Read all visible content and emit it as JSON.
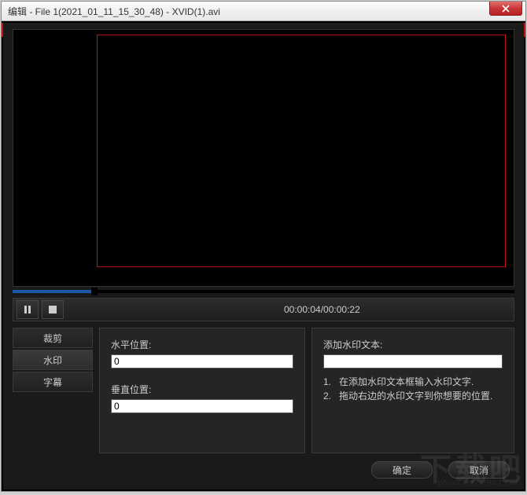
{
  "window": {
    "title": "编辑 - File 1(2021_01_11_15_30_48) - XVID(1).avi"
  },
  "player": {
    "time_display": "00:00:04/00:00:22"
  },
  "tabs": {
    "crop": "裁剪",
    "watermark": "水印",
    "subtitle": "字幕"
  },
  "watermark_panel": {
    "h_pos_label": "水平位置:",
    "h_pos_value": "0",
    "v_pos_label": "垂直位置:",
    "v_pos_value": "0",
    "add_text_label": "添加水印文本:",
    "add_text_value": "",
    "instr1_num": "1.",
    "instr1_text": "在添加水印文本框输入水印文字.",
    "instr2_num": "2.",
    "instr2_text": "拖动右边的水印文字到你想要的位置."
  },
  "footer": {
    "ok": "确定",
    "cancel": "取消"
  },
  "bg_watermark": {
    "main": "下载吧",
    "sub": "WWW.XIAZAIBA.COM"
  }
}
